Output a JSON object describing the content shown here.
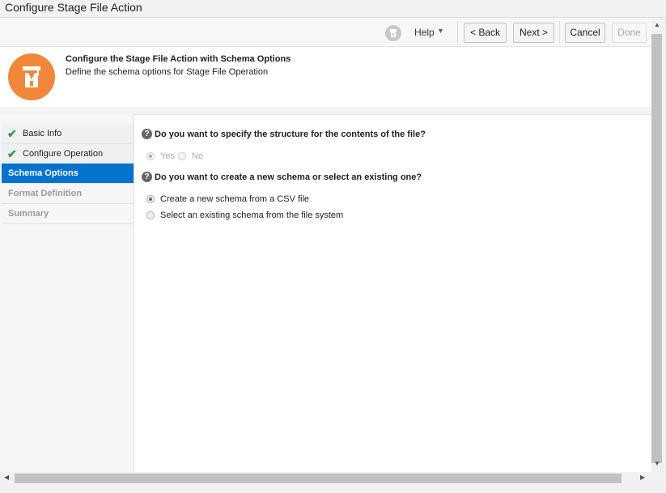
{
  "window": {
    "title": "Configure Stage File Action"
  },
  "toolbar": {
    "help_label": "Help",
    "back_label": "< Back",
    "next_label": "Next >",
    "cancel_label": "Cancel",
    "done_label": "Done"
  },
  "header": {
    "title": "Configure the Stage File Action with Schema Options",
    "description": "Define the schema options for Stage File Operation"
  },
  "nav": {
    "items": [
      {
        "label": "Basic Info",
        "state": "done"
      },
      {
        "label": "Configure Operation",
        "state": "done"
      },
      {
        "label": "Schema Options",
        "state": "active"
      },
      {
        "label": "Format Definition",
        "state": "disabled"
      },
      {
        "label": "Summary",
        "state": "disabled"
      }
    ]
  },
  "content": {
    "question1": {
      "text": "Do you want to specify the structure for the contents of the file?",
      "options": [
        {
          "label": "Yes",
          "selected": true
        },
        {
          "label": "No",
          "selected": false
        }
      ]
    },
    "question2": {
      "text": "Do you want to create a new schema or select an existing one?",
      "options": [
        {
          "label": "Create a new schema from a CSV file",
          "selected": true
        },
        {
          "label": "Select an existing schema from the file system",
          "selected": false
        }
      ]
    }
  },
  "colors": {
    "accent": "#0572ce",
    "logo": "#f0873a",
    "check": "#3a9a3a"
  },
  "icons": {
    "help": "help-circle-icon",
    "logo": "graduate-icon",
    "check": "check-icon",
    "question": "question-icon"
  }
}
